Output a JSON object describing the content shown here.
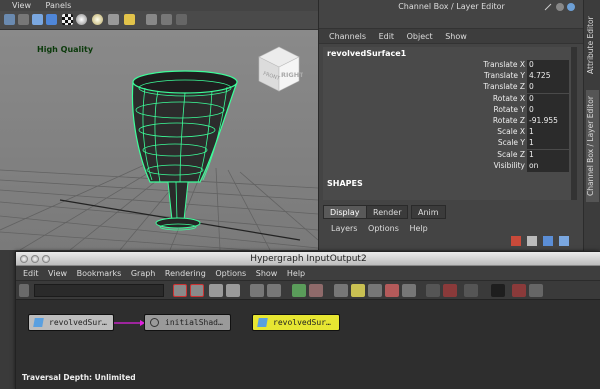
{
  "viewport": {
    "menu": [
      "View",
      "Panels"
    ],
    "hud_label": "High Quality",
    "viewcube": {
      "front": "FRONT",
      "right": "RIGHT"
    }
  },
  "channel_box": {
    "title": "Channel Box / Layer Editor",
    "menu": [
      "Channels",
      "Edit",
      "Object",
      "Show"
    ],
    "object_name": "revolvedSurface1",
    "attributes": [
      {
        "label": "Translate X",
        "value": "0"
      },
      {
        "label": "Translate Y",
        "value": "4.725"
      },
      {
        "label": "Translate Z",
        "value": "0"
      },
      {
        "label": "Rotate X",
        "value": "0"
      },
      {
        "label": "Rotate Y",
        "value": "0"
      },
      {
        "label": "Rotate Z",
        "value": "-91.955"
      },
      {
        "label": "Scale X",
        "value": "1"
      },
      {
        "label": "Scale Y",
        "value": "1"
      },
      {
        "label": "Scale Z",
        "value": "1"
      },
      {
        "label": "Visibility",
        "value": "on"
      }
    ],
    "shapes_label": "SHAPES"
  },
  "layer_editor": {
    "tabs": [
      "Display",
      "Render",
      "Anim"
    ],
    "active_tab": "Display",
    "menu": [
      "Layers",
      "Options",
      "Help"
    ]
  },
  "side_tabs": [
    "Attribute Editor",
    "Channel Box / Layer Editor"
  ],
  "hypergraph": {
    "title": "Hypergraph InputOutput2",
    "menu": [
      "Edit",
      "View",
      "Bookmarks",
      "Graph",
      "Rendering",
      "Options",
      "Show",
      "Help"
    ],
    "nodes": [
      {
        "label": "revolvedSur…",
        "color": "#bdbdbd"
      },
      {
        "label": "initialShad…",
        "color": "#9a9a9a"
      },
      {
        "label": "revolvedSur…",
        "color": "#e7e632"
      }
    ],
    "status": "Traversal Depth: Unlimited"
  },
  "colors": {
    "wireframe": "#3cff9a",
    "selection_node": "#e7e632",
    "connection": "#e020e0"
  }
}
